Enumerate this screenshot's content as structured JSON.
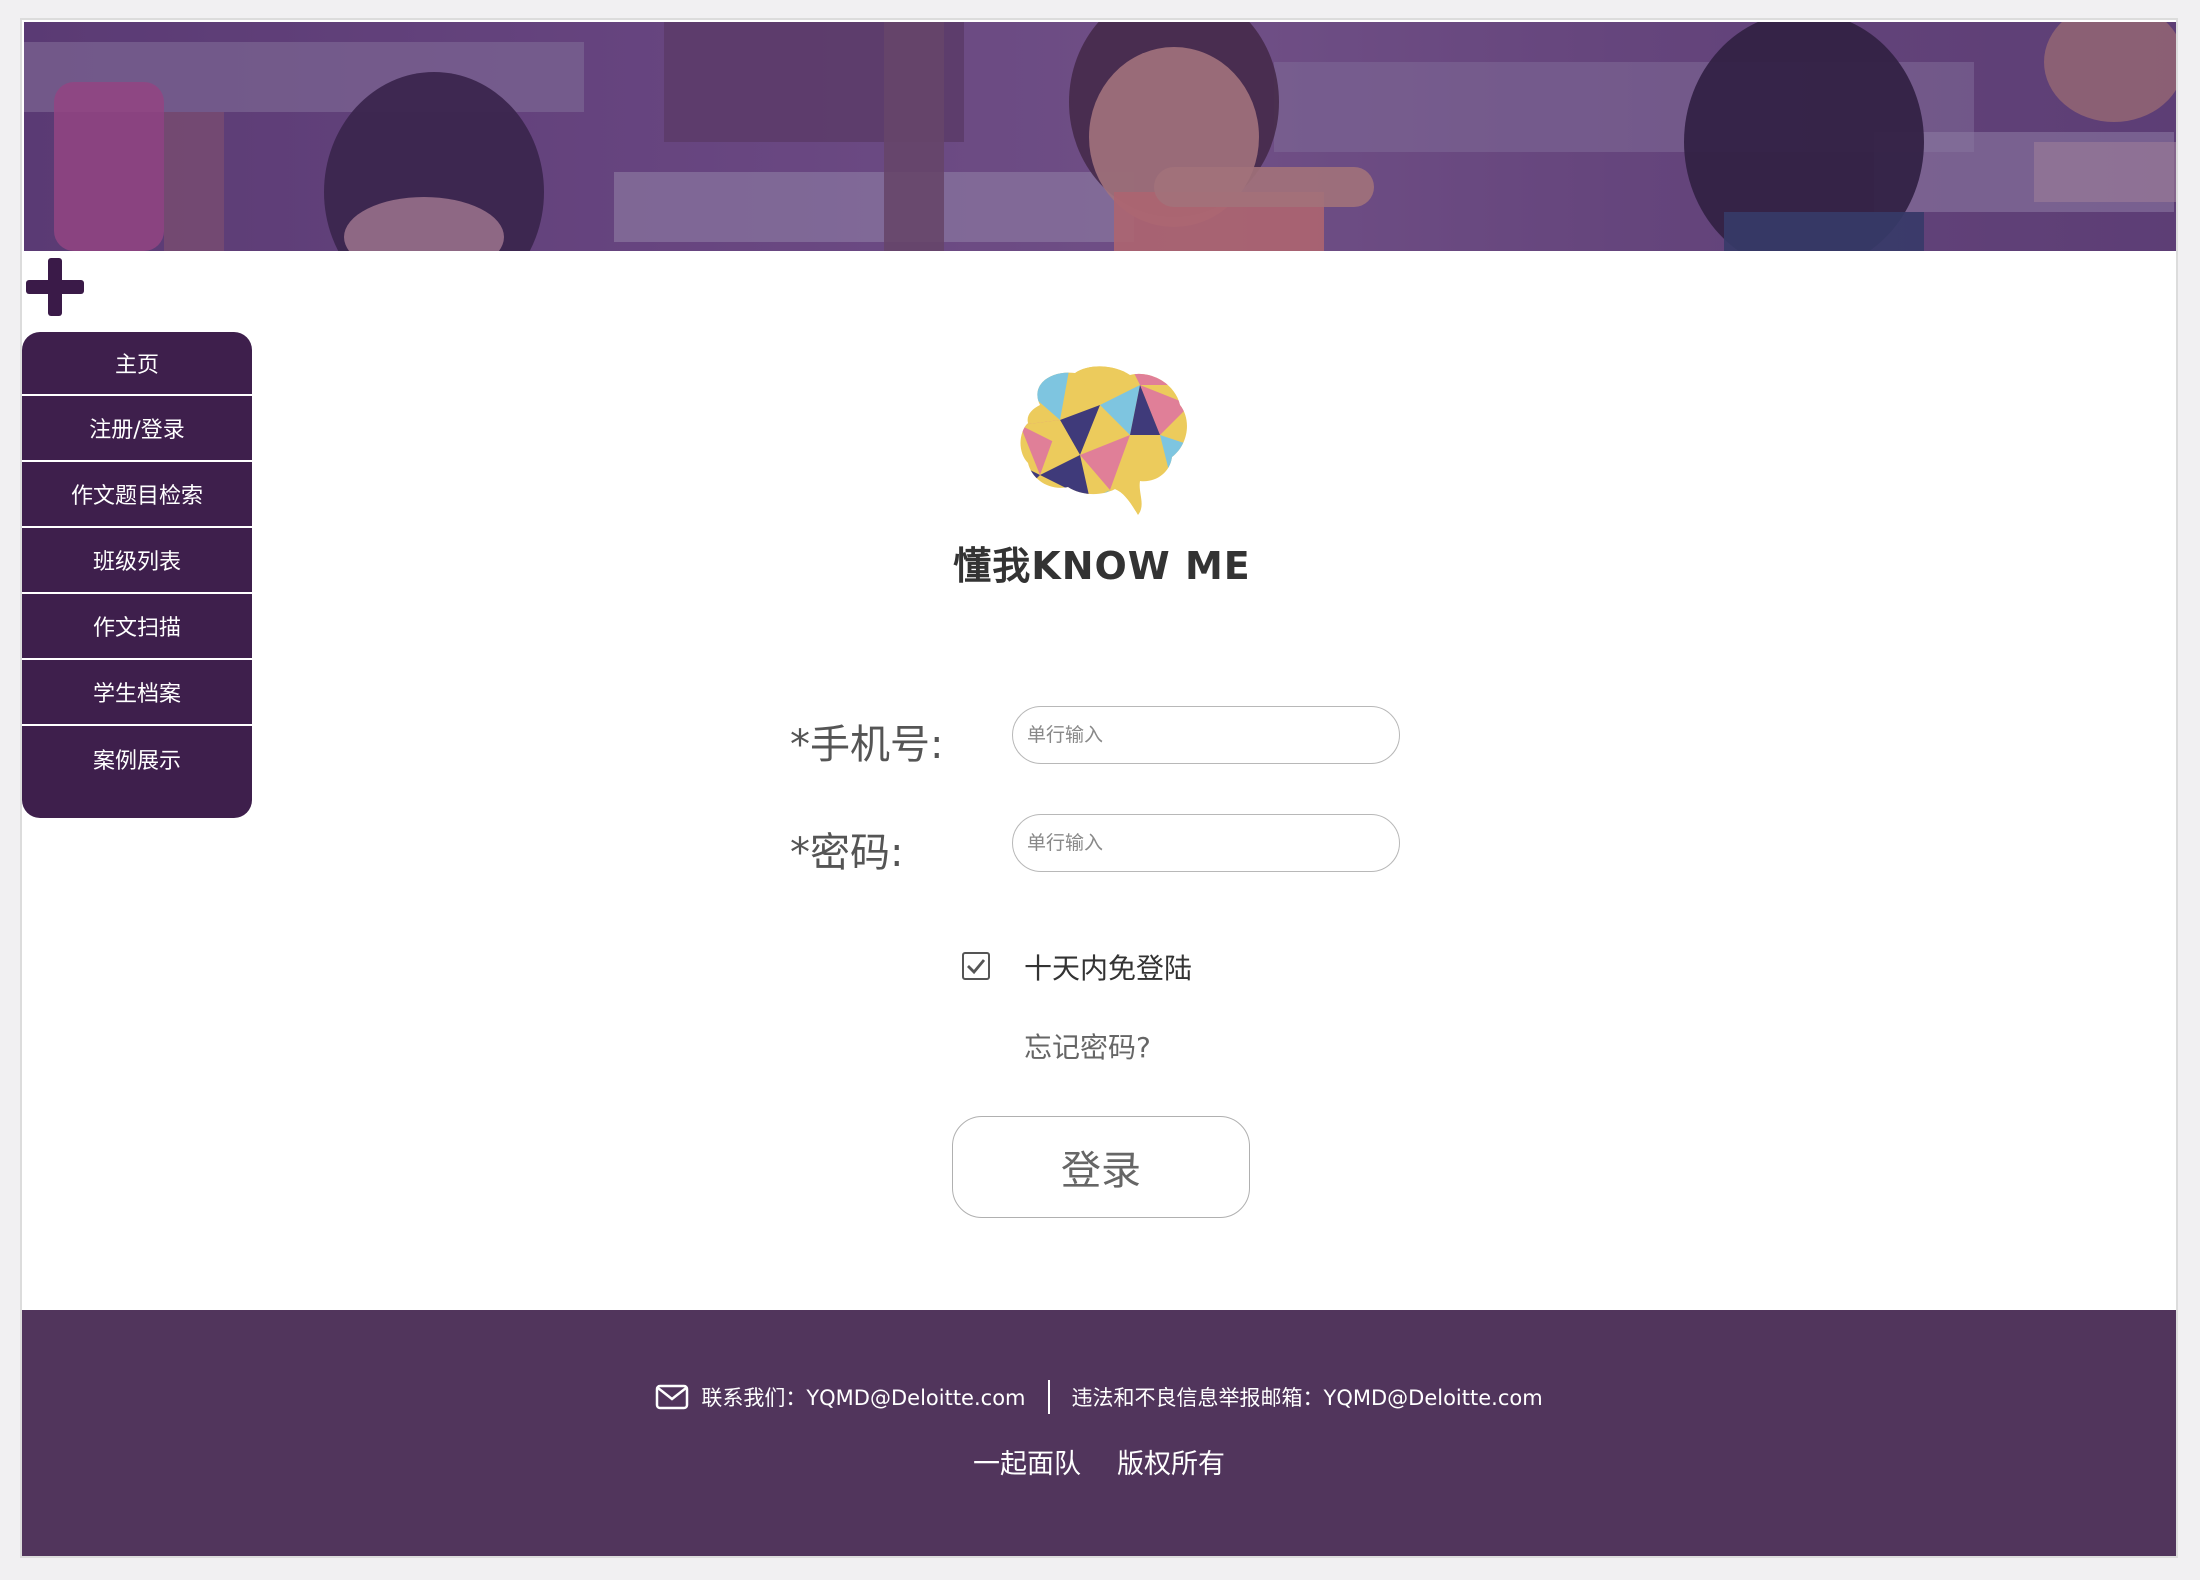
{
  "banner": {
    "description_icon": "classroom-photo"
  },
  "sidebar": {
    "toggle_icon": "plus-icon",
    "items": [
      {
        "label": "主页"
      },
      {
        "label": "注册/登录"
      },
      {
        "label": "作文题目检索"
      },
      {
        "label": "班级列表"
      },
      {
        "label": "作文扫描"
      },
      {
        "label": "学生档案"
      },
      {
        "label": "案例展示"
      }
    ]
  },
  "logo": {
    "text": "懂我KNOW ME",
    "icon": "brain-icon"
  },
  "form": {
    "phone_label": "*手机号:",
    "phone_placeholder": "单行输入",
    "password_label": "*密码:",
    "password_placeholder": "单行输入",
    "remember_label": "十天内免登陆",
    "remember_checked": true,
    "forgot_label": "忘记密码?",
    "login_label": "登录"
  },
  "footer": {
    "contact": "联系我们：YQMD@Deloitte.com",
    "report": "违法和不良信息举报邮箱：YQMD@Deloitte.com",
    "team": "一起面队",
    "copyright": "版权所有"
  },
  "colors": {
    "sidebar_bg": "#3e1f4c",
    "footer_bg": "#51355c",
    "banner_tint": "#6a4a80"
  }
}
